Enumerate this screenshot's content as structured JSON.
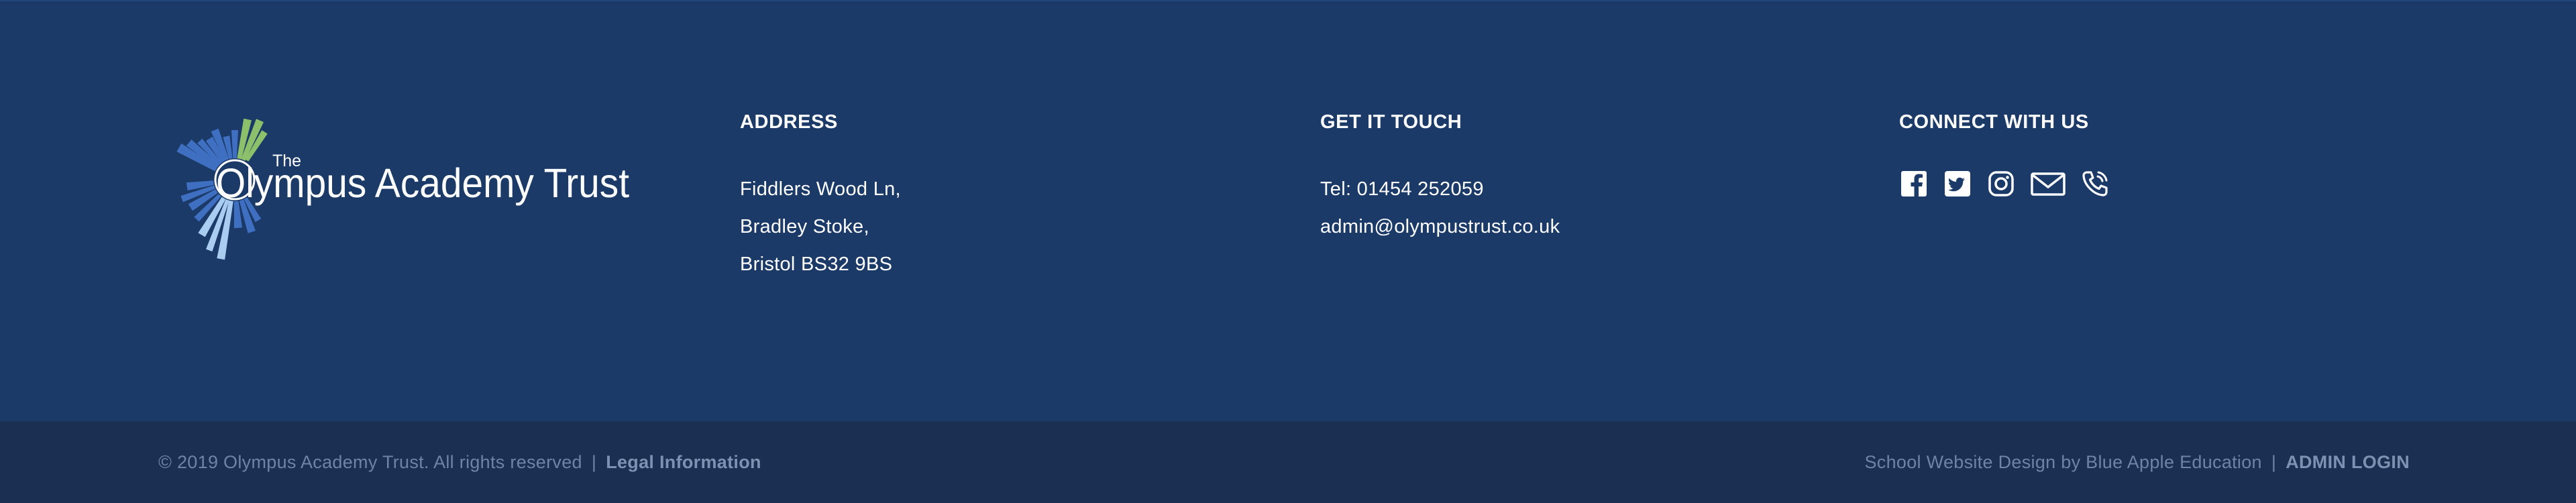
{
  "brand": {
    "logo_small_text": "The",
    "logo_text": "Olympus Academy Trust",
    "colors": {
      "background": "#1b3a68",
      "bottom_bar": "#1b2f52",
      "logo_blue": "#3f6fc0",
      "logo_light_blue": "#a9cdf0",
      "logo_green": "#8cc06a"
    }
  },
  "address": {
    "heading": "ADDRESS",
    "lines": [
      "Fiddlers Wood Ln,",
      "Bradley Stoke,",
      "Bristol BS32 9BS"
    ]
  },
  "contact": {
    "heading": "GET IT TOUCH",
    "phone": "Tel: 01454 252059",
    "email": "admin@olympustrust.co.uk"
  },
  "connect": {
    "heading": "CONNECT WITH US",
    "icons": [
      "facebook-icon",
      "twitter-icon",
      "instagram-icon",
      "mail-icon",
      "phone-icon"
    ]
  },
  "bottom": {
    "copyright": "© 2019 Olympus Academy Trust. All rights reserved",
    "separator": "|",
    "legal_link": "Legal Information",
    "credit": "School Website Design by Blue Apple Education",
    "admin_link": "ADMIN LOGIN"
  }
}
